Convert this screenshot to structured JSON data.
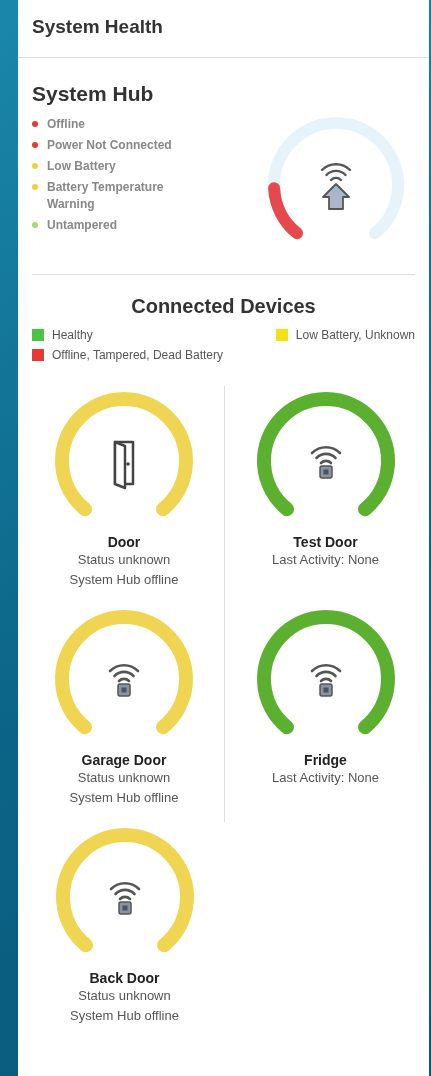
{
  "header": {
    "title": "System Health"
  },
  "hub": {
    "title": "System Hub",
    "statuses": [
      {
        "label": "Offline",
        "color": "#e53935"
      },
      {
        "label": "Power Not Connected",
        "color": "#e53935"
      },
      {
        "label": "Low Battery",
        "color": "#f2d03b"
      },
      {
        "label": "Battery Temperature Warning",
        "color": "#f2d03b"
      },
      {
        "label": "Untampered",
        "color": "#a5d97a"
      }
    ]
  },
  "devices_section": {
    "title": "Connected Devices",
    "legend": [
      {
        "label": "Healthy",
        "color": "#4cc443"
      },
      {
        "label": "Low Battery, Unknown",
        "color": "#f5e011"
      },
      {
        "label": "Offline, Tampered, Dead Battery",
        "color": "#e53935"
      }
    ],
    "devices": [
      {
        "name": "Door",
        "kind": "door",
        "color": "#f0d552",
        "lines": [
          "Status unknown",
          "System Hub offline"
        ]
      },
      {
        "name": "Test Door",
        "kind": "sensor",
        "color": "#5cb030",
        "lines": [
          "Last Activity: None"
        ]
      },
      {
        "name": "Garage Door",
        "kind": "sensor",
        "color": "#f0d552",
        "lines": [
          "Status unknown",
          "System Hub offline"
        ]
      },
      {
        "name": "Fridge",
        "kind": "sensor",
        "color": "#5cb030",
        "lines": [
          "Last Activity: None"
        ]
      },
      {
        "name": "Back Door",
        "kind": "sensor",
        "color": "#f0d552",
        "lines": [
          "Status unknown",
          "System Hub offline"
        ]
      }
    ]
  }
}
